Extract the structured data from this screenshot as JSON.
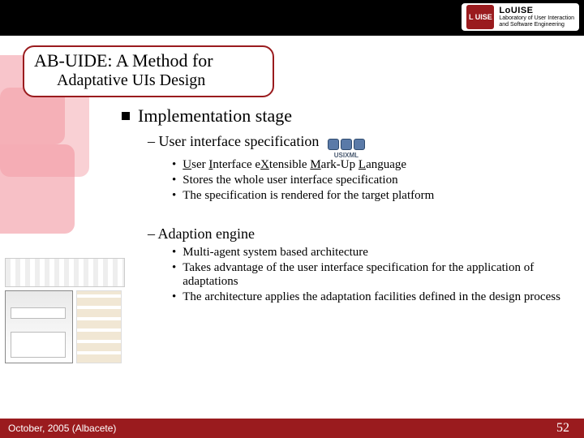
{
  "brand": {
    "badge": "L UISE",
    "name": "LoUISE",
    "tagline1": "Laboratory of User Interaction",
    "tagline2": "and Software Engineering"
  },
  "title": {
    "line1": "AB-UIDE: A Method for",
    "line2": "Adaptative UIs Design"
  },
  "content": {
    "h1": "Implementation stage",
    "secA": {
      "heading": "– User interface specification",
      "logo_label": "USIXML",
      "bullets": [
        {
          "prefix": "U",
          "mid1": "ser ",
          "u2": "I",
          "mid2": "nterface e",
          "u3": "X",
          "mid3": "tensible ",
          "u4": "M",
          "mid4": "ark-Up ",
          "u5": "L",
          "mid5": "anguage"
        },
        "Stores the whole user interface specification",
        "The specification is rendered for the target platform"
      ]
    },
    "secB": {
      "heading": "– Adaption engine",
      "bullets": [
        "Multi-agent system based architecture",
        "Takes advantage of the user interface specification for the application of adaptations",
        "The architecture applies the adaptation facilities defined in the design process"
      ]
    }
  },
  "footer": {
    "left": "October, 2005 (Albacete)",
    "page": "52"
  }
}
